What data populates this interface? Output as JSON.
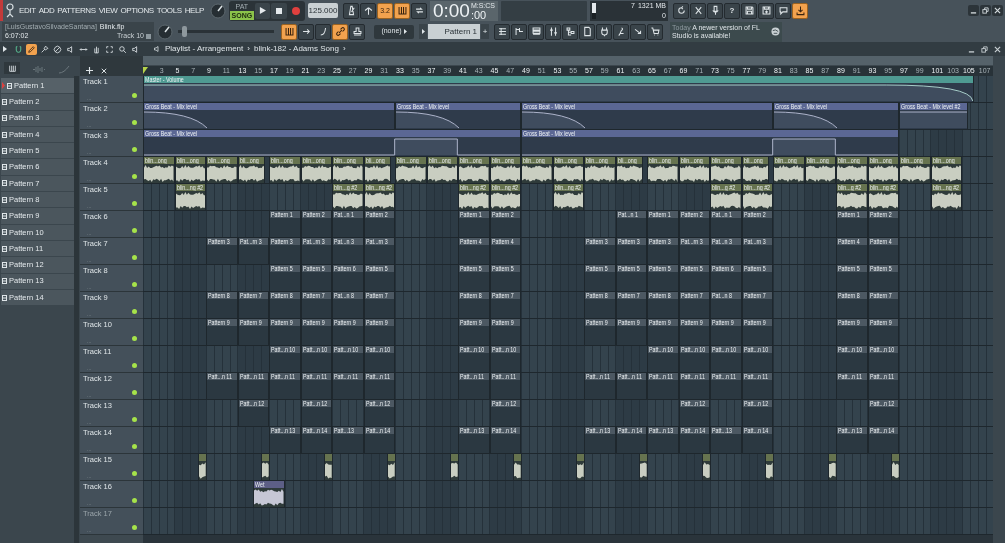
{
  "menu": [
    "EDIT",
    "ADD",
    "PATTERNS",
    "VIEW",
    "OPTIONS",
    "TOOLS",
    "HELP"
  ],
  "transport": {
    "modes": [
      {
        "label": "PAT",
        "selected": false
      },
      {
        "label": "SONG",
        "selected": true
      }
    ],
    "tempo": "125.000"
  },
  "toolbar_top": [
    {
      "kind": "metronome",
      "on": false
    },
    {
      "kind": "antenna",
      "on": false
    },
    {
      "kind": "countdown",
      "label": "3.2",
      "on": true
    },
    {
      "kind": "keys",
      "on": true
    },
    {
      "kind": "loop",
      "on": false
    }
  ],
  "clock": {
    "format": "M:S:CS",
    "time": "0:00",
    "fraction": ":00"
  },
  "monitor": {
    "cpu": "7",
    "memory": "1321 MB",
    "polyphony": "0"
  },
  "toolbar_right": [
    {
      "kind": "refresh",
      "on": false
    },
    {
      "kind": "cut",
      "on": false
    },
    {
      "kind": "mic",
      "on": false
    },
    {
      "kind": "help",
      "label": "?",
      "on": false
    },
    {
      "kind": "save",
      "on": false
    },
    {
      "kind": "saveas",
      "on": false
    },
    {
      "kind": "chat",
      "on": false
    },
    {
      "kind": "download",
      "on": true
    }
  ],
  "hint": {
    "owner": "[LuisGustavoSilvadeSantana]",
    "file": "Blink.flp",
    "time": "6:07:02",
    "target": "Track 10"
  },
  "pitch": {
    "level": 0.04
  },
  "toolbar_mid": [
    {
      "kind": "keys",
      "on": true
    },
    {
      "kind": "arrow",
      "on": false
    },
    {
      "kind": "curve",
      "on": false
    },
    {
      "kind": "link",
      "on": true
    },
    {
      "kind": "stamp",
      "on": false
    }
  ],
  "channel_target": "(none)",
  "pattern_selector": {
    "value": "Pattern 1",
    "add": "+"
  },
  "toolbar_windows": [
    {
      "kind": "playlist",
      "on": false
    },
    {
      "kind": "stepseq",
      "on": false
    },
    {
      "kind": "channels",
      "on": false
    },
    {
      "kind": "mixer",
      "on": false
    },
    {
      "kind": "browser",
      "on": false
    },
    {
      "kind": "page",
      "on": false
    },
    {
      "kind": "plug",
      "on": false
    },
    {
      "kind": "person",
      "on": false
    },
    {
      "kind": "send",
      "on": false
    },
    {
      "kind": "cart",
      "on": false
    }
  ],
  "news": {
    "date": "Today",
    "message": "A newer version of FL Studio is available!"
  },
  "playlist": {
    "tools": [
      {
        "kind": "magnet",
        "selected": false
      },
      {
        "kind": "pencil",
        "selected": true
      },
      {
        "kind": "brush",
        "selected": false
      },
      {
        "kind": "mute",
        "selected": false
      },
      {
        "kind": "speaker",
        "selected": false
      },
      {
        "kind": "slip",
        "selected": false
      },
      {
        "kind": "hand",
        "selected": false
      },
      {
        "kind": "select",
        "selected": false
      },
      {
        "kind": "zoom",
        "selected": false
      },
      {
        "kind": "speaker",
        "selected": false
      }
    ],
    "breadcrumb": [
      "Playlist - Arrangement",
      "›",
      "blink-182 - Adams Song",
      "›"
    ],
    "ruler": [
      "3",
      "5",
      "7",
      "9",
      "11",
      "13",
      "15",
      "17",
      "19",
      "21",
      "23",
      "25",
      "27",
      "29",
      "31",
      "33",
      "35",
      "37",
      "39",
      "41",
      "43",
      "45",
      "47",
      "49",
      "51",
      "53",
      "55",
      "57",
      "59",
      "61",
      "63",
      "65",
      "67",
      "69",
      "71",
      "73",
      "75",
      "77",
      "79",
      "81",
      "83",
      "85",
      "87",
      "89",
      "91",
      "93",
      "95",
      "97",
      "99",
      "101",
      "103",
      "105",
      "107"
    ],
    "patterns": [
      {
        "label": "Pattern 1",
        "selected": true
      },
      {
        "label": "Pattern 2",
        "selected": false
      },
      {
        "label": "Pattern 3",
        "selected": false
      },
      {
        "label": "Pattern 4",
        "selected": false
      },
      {
        "label": "Pattern 5",
        "selected": false
      },
      {
        "label": "Pattern 6",
        "selected": false
      },
      {
        "label": "Pattern 7",
        "selected": false
      },
      {
        "label": "Pattern 8",
        "selected": false
      },
      {
        "label": "Pattern 9",
        "selected": false
      },
      {
        "label": "Pattern 10",
        "selected": false
      },
      {
        "label": "Pattern 11",
        "selected": false
      },
      {
        "label": "Pattern 12",
        "selected": false
      },
      {
        "label": "Pattern 13",
        "selected": false
      },
      {
        "label": "Pattern 14",
        "selected": false
      }
    ],
    "tracks": [
      {
        "name": "Track 1",
        "options": "...",
        "enabled": true,
        "dimmed": false,
        "color": "#4f9a92",
        "clips": [
          {
            "kind": "automation",
            "label": "Master - Volume"
          }
        ]
      },
      {
        "name": "Track 2",
        "options": "...",
        "enabled": true,
        "dimmed": false,
        "color": "#5b6794",
        "clips": [
          {
            "kind": "automation",
            "label": "Gross Beat - Mix level"
          },
          {
            "kind": "automation",
            "label": "Gross Beat - Mix level"
          },
          {
            "kind": "automation",
            "label": "Gross Beat - Mix level"
          },
          {
            "kind": "automation",
            "label": "Gross Beat - Mix level"
          },
          {
            "kind": "automation",
            "label": "Gross Beat - Mix level #2"
          }
        ]
      },
      {
        "name": "Track 3",
        "options": "...",
        "enabled": true,
        "dimmed": false,
        "color": "#5b6794",
        "clips": [
          {
            "kind": "automation",
            "label": "Gross Beat - Mix level"
          },
          {
            "kind": "automation",
            "label": "Gross Beat - Mix level"
          }
        ]
      },
      {
        "name": "Track 4",
        "options": "...",
        "enabled": true,
        "dimmed": false,
        "color": "#66734f",
        "clips": [
          {
            "kind": "audio",
            "label": "blin...ong"
          },
          {
            "kind": "audio",
            "label": "blin...ong"
          },
          {
            "kind": "audio",
            "label": "blin...ong"
          },
          {
            "kind": "audio",
            "label": "bli...ong"
          },
          {
            "kind": "audio",
            "label": "blin...ong"
          },
          {
            "kind": "audio",
            "label": "blin...ong"
          },
          {
            "kind": "audio",
            "label": "blin...ong"
          },
          {
            "kind": "audio",
            "label": "bli...ong"
          },
          {
            "kind": "audio",
            "label": "blin...ong"
          },
          {
            "kind": "audio",
            "label": "blin...ong"
          },
          {
            "kind": "audio",
            "label": "blin...ong"
          },
          {
            "kind": "audio",
            "label": "blin...ong"
          },
          {
            "kind": "audio",
            "label": "blin...ong"
          },
          {
            "kind": "audio",
            "label": "blin...ong"
          },
          {
            "kind": "audio",
            "label": "blin...ong"
          },
          {
            "kind": "audio",
            "label": "bli...ong"
          },
          {
            "kind": "audio",
            "label": "blin...ong"
          },
          {
            "kind": "audio",
            "label": "blin...ong"
          },
          {
            "kind": "audio",
            "label": "blin...ong"
          },
          {
            "kind": "audio",
            "label": "bli...ong"
          },
          {
            "kind": "audio",
            "label": "blin...ong"
          },
          {
            "kind": "audio",
            "label": "blin...ong"
          },
          {
            "kind": "audio",
            "label": "blin...ong"
          },
          {
            "kind": "audio",
            "label": "blin...ong"
          },
          {
            "kind": "audio",
            "label": "blin...ong"
          },
          {
            "kind": "audio",
            "label": "blin...ong"
          }
        ]
      },
      {
        "name": "Track 5",
        "options": "...",
        "enabled": true,
        "dimmed": false,
        "color": "#66734f",
        "clips": [
          {
            "kind": "audio",
            "label": "blin...ng #2"
          },
          {
            "kind": "audio",
            "label": "blin...g #2"
          },
          {
            "kind": "audio",
            "label": "blin...ng #2"
          },
          {
            "kind": "audio",
            "label": "blin...ng #2"
          },
          {
            "kind": "audio",
            "label": "blin...ng #2"
          },
          {
            "kind": "audio",
            "label": "blin...ng #2"
          },
          {
            "kind": "audio",
            "label": "blin...g #2"
          },
          {
            "kind": "audio",
            "label": "blin...ng #2"
          },
          {
            "kind": "audio",
            "label": "blin...g #2"
          },
          {
            "kind": "audio",
            "label": "blin...ng #2"
          },
          {
            "kind": "audio",
            "label": "blin...ng #2"
          }
        ]
      },
      {
        "name": "Track 6",
        "options": "...",
        "enabled": true,
        "dimmed": false,
        "color": "#4c5862",
        "clips": [
          {
            "kind": "pattern",
            "label": "Pattern 1"
          },
          {
            "kind": "pattern",
            "label": "Pattern 2"
          },
          {
            "kind": "pattern",
            "label": "Pat...n 1"
          },
          {
            "kind": "pattern",
            "label": "Pattern 2"
          },
          {
            "kind": "pattern",
            "label": "Pattern 1"
          },
          {
            "kind": "pattern",
            "label": "Pattern 2"
          },
          {
            "kind": "pattern",
            "label": "Pat...n 1"
          },
          {
            "kind": "pattern",
            "label": "Pattern 1"
          },
          {
            "kind": "pattern",
            "label": "Pattern 2"
          },
          {
            "kind": "pattern",
            "label": "Pat...n 1"
          },
          {
            "kind": "pattern",
            "label": "Pattern 2"
          },
          {
            "kind": "pattern",
            "label": "Pattern 1"
          },
          {
            "kind": "pattern",
            "label": "Pattern 2"
          }
        ]
      },
      {
        "name": "Track 7",
        "options": "...",
        "enabled": true,
        "dimmed": false,
        "color": "#4c5862",
        "clips": [
          {
            "kind": "pattern",
            "label": "Pattern 3"
          },
          {
            "kind": "pattern",
            "label": "Pat...rn 3"
          },
          {
            "kind": "pattern",
            "label": "Pattern 3"
          },
          {
            "kind": "pattern",
            "label": "Pat...rn 3"
          },
          {
            "kind": "pattern",
            "label": "Pat...n 3"
          },
          {
            "kind": "pattern",
            "label": "Pat...rn 3"
          },
          {
            "kind": "pattern",
            "label": "Pattern 4"
          },
          {
            "kind": "pattern",
            "label": "Pattern 4"
          },
          {
            "kind": "pattern",
            "label": "Pattern 3"
          },
          {
            "kind": "pattern",
            "label": "Pattern 3"
          },
          {
            "kind": "pattern",
            "label": "Pattern 3"
          },
          {
            "kind": "pattern",
            "label": "Pat...rn 3"
          },
          {
            "kind": "pattern",
            "label": "Pat...n 3"
          },
          {
            "kind": "pattern",
            "label": "Pat...rn 3"
          },
          {
            "kind": "pattern",
            "label": "Pattern 4"
          },
          {
            "kind": "pattern",
            "label": "Pattern 4"
          }
        ]
      },
      {
        "name": "Track 8",
        "options": "...",
        "enabled": true,
        "dimmed": false,
        "color": "#4c5862",
        "clips": [
          {
            "kind": "pattern",
            "label": "Pattern 5"
          },
          {
            "kind": "pattern",
            "label": "Pattern 5"
          },
          {
            "kind": "pattern",
            "label": "Pattern 6"
          },
          {
            "kind": "pattern",
            "label": "Pattern 5"
          },
          {
            "kind": "pattern",
            "label": "Pattern 5"
          },
          {
            "kind": "pattern",
            "label": "Pattern 5"
          },
          {
            "kind": "pattern",
            "label": "Pattern 5"
          },
          {
            "kind": "pattern",
            "label": "Pattern 5"
          },
          {
            "kind": "pattern",
            "label": "Pattern 5"
          },
          {
            "kind": "pattern",
            "label": "Pattern 5"
          },
          {
            "kind": "pattern",
            "label": "Pattern 6"
          },
          {
            "kind": "pattern",
            "label": "Pattern 5"
          },
          {
            "kind": "pattern",
            "label": "Pattern 5"
          },
          {
            "kind": "pattern",
            "label": "Pattern 5"
          }
        ]
      },
      {
        "name": "Track 9",
        "options": "...",
        "enabled": true,
        "dimmed": false,
        "color": "#4c5862",
        "clips": [
          {
            "kind": "pattern",
            "label": "Pattern 8"
          },
          {
            "kind": "pattern",
            "label": "Pattern 7"
          },
          {
            "kind": "pattern",
            "label": "Pattern 8"
          },
          {
            "kind": "pattern",
            "label": "Pattern 7"
          },
          {
            "kind": "pattern",
            "label": "Pat...n 8"
          },
          {
            "kind": "pattern",
            "label": "Pattern 7"
          },
          {
            "kind": "pattern",
            "label": "Pattern 8"
          },
          {
            "kind": "pattern",
            "label": "Pattern 7"
          },
          {
            "kind": "pattern",
            "label": "Pattern 8"
          },
          {
            "kind": "pattern",
            "label": "Pattern 7"
          },
          {
            "kind": "pattern",
            "label": "Pattern 8"
          },
          {
            "kind": "pattern",
            "label": "Pattern 7"
          },
          {
            "kind": "pattern",
            "label": "Pat...n 8"
          },
          {
            "kind": "pattern",
            "label": "Pattern 7"
          },
          {
            "kind": "pattern",
            "label": "Pattern 8"
          },
          {
            "kind": "pattern",
            "label": "Pattern 7"
          }
        ]
      },
      {
        "name": "Track 10",
        "options": "...",
        "enabled": true,
        "dimmed": false,
        "color": "#4c5862",
        "clips": [
          {
            "kind": "pattern",
            "label": "Pattern 9"
          },
          {
            "kind": "pattern",
            "label": "Pattern 9"
          },
          {
            "kind": "pattern",
            "label": "Pattern 9"
          },
          {
            "kind": "pattern",
            "label": "Pattern 9"
          },
          {
            "kind": "pattern",
            "label": "Pattern 9"
          },
          {
            "kind": "pattern",
            "label": "Pattern 9"
          },
          {
            "kind": "pattern",
            "label": "Pattern 9"
          },
          {
            "kind": "pattern",
            "label": "Pattern 9"
          },
          {
            "kind": "pattern",
            "label": "Pattern 9"
          },
          {
            "kind": "pattern",
            "label": "Pattern 9"
          },
          {
            "kind": "pattern",
            "label": "Pattern 9"
          },
          {
            "kind": "pattern",
            "label": "Pattern 9"
          },
          {
            "kind": "pattern",
            "label": "Pattern 9"
          },
          {
            "kind": "pattern",
            "label": "Pattern 9"
          },
          {
            "kind": "pattern",
            "label": "Pattern 9"
          },
          {
            "kind": "pattern",
            "label": "Pattern 9"
          }
        ]
      },
      {
        "name": "Track 11",
        "options": "...",
        "enabled": true,
        "dimmed": false,
        "color": "#4c5862",
        "clips": [
          {
            "kind": "pattern",
            "label": "Patt...n 10"
          },
          {
            "kind": "pattern",
            "label": "Patt...n 10"
          },
          {
            "kind": "pattern",
            "label": "Patt...n 10"
          },
          {
            "kind": "pattern",
            "label": "Patt...n 10"
          },
          {
            "kind": "pattern",
            "label": "Patt...n 10"
          },
          {
            "kind": "pattern",
            "label": "Patt...n 10"
          },
          {
            "kind": "pattern",
            "label": "Patt...n 10"
          },
          {
            "kind": "pattern",
            "label": "Patt...n 10"
          },
          {
            "kind": "pattern",
            "label": "Patt...n 10"
          },
          {
            "kind": "pattern",
            "label": "Patt...n 10"
          },
          {
            "kind": "pattern",
            "label": "Patt...n 10"
          },
          {
            "kind": "pattern",
            "label": "Patt...n 10"
          }
        ]
      },
      {
        "name": "Track 12",
        "options": "...",
        "enabled": true,
        "dimmed": false,
        "color": "#4c5862",
        "clips": [
          {
            "kind": "pattern",
            "label": "Patt...n 11"
          },
          {
            "kind": "pattern",
            "label": "Patt...n 11"
          },
          {
            "kind": "pattern",
            "label": "Patt...n 11"
          },
          {
            "kind": "pattern",
            "label": "Patt...n 11"
          },
          {
            "kind": "pattern",
            "label": "Patt...n 11"
          },
          {
            "kind": "pattern",
            "label": "Patt...n 11"
          },
          {
            "kind": "pattern",
            "label": "Patt...n 11"
          },
          {
            "kind": "pattern",
            "label": "Patt...n 11"
          },
          {
            "kind": "pattern",
            "label": "Patt...n 11"
          },
          {
            "kind": "pattern",
            "label": "Patt...n 11"
          },
          {
            "kind": "pattern",
            "label": "Patt...n 11"
          },
          {
            "kind": "pattern",
            "label": "Patt...n 11"
          },
          {
            "kind": "pattern",
            "label": "Patt...n 11"
          },
          {
            "kind": "pattern",
            "label": "Patt...n 11"
          },
          {
            "kind": "pattern",
            "label": "Patt...n 11"
          },
          {
            "kind": "pattern",
            "label": "Patt...n 11"
          }
        ]
      },
      {
        "name": "Track 13",
        "options": "...",
        "enabled": true,
        "dimmed": false,
        "color": "#4c5862",
        "clips": [
          {
            "kind": "pattern",
            "label": "Patt...n 12"
          },
          {
            "kind": "pattern",
            "label": "Patt...n 12"
          },
          {
            "kind": "pattern",
            "label": "Patt...n 12"
          },
          {
            "kind": "pattern",
            "label": "Patt...n 12"
          },
          {
            "kind": "pattern",
            "label": "Patt...n 12"
          },
          {
            "kind": "pattern",
            "label": "Patt...n 12"
          },
          {
            "kind": "pattern",
            "label": "Patt...n 12"
          }
        ]
      },
      {
        "name": "Track 14",
        "options": "...",
        "enabled": true,
        "dimmed": false,
        "color": "#4c5862",
        "clips": [
          {
            "kind": "pattern",
            "label": "Patt...n 13"
          },
          {
            "kind": "pattern",
            "label": "Patt...n 14"
          },
          {
            "kind": "pattern",
            "label": "Patt...13"
          },
          {
            "kind": "pattern",
            "label": "Patt...n 14"
          },
          {
            "kind": "pattern",
            "label": "Patt...n 13"
          },
          {
            "kind": "pattern",
            "label": "Patt...n 14"
          },
          {
            "kind": "pattern",
            "label": "Patt...n 13"
          },
          {
            "kind": "pattern",
            "label": "Patt...n 14"
          },
          {
            "kind": "pattern",
            "label": "Patt...n 13"
          },
          {
            "kind": "pattern",
            "label": "Patt...n 14"
          },
          {
            "kind": "pattern",
            "label": "Patt...13"
          },
          {
            "kind": "pattern",
            "label": "Patt...n 14"
          },
          {
            "kind": "pattern",
            "label": "Patt...n 13"
          },
          {
            "kind": "pattern",
            "label": "Patt...n 14"
          }
        ]
      },
      {
        "name": "Track 15",
        "options": "...",
        "enabled": true,
        "dimmed": false,
        "color": "#66734f",
        "clips": [
          {
            "kind": "audio"
          },
          {
            "kind": "audio"
          },
          {
            "kind": "audio"
          },
          {
            "kind": "audio"
          },
          {
            "kind": "audio"
          },
          {
            "kind": "audio"
          },
          {
            "kind": "audio"
          },
          {
            "kind": "audio"
          },
          {
            "kind": "audio"
          },
          {
            "kind": "audio"
          },
          {
            "kind": "audio"
          },
          {
            "kind": "audio"
          }
        ]
      },
      {
        "name": "Track 16",
        "options": "...",
        "enabled": true,
        "dimmed": false,
        "color": "#5d5f86",
        "clips": [
          {
            "kind": "audio",
            "label": "Wet"
          }
        ]
      },
      {
        "name": "Track 17",
        "options": "...",
        "enabled": true,
        "dimmed": true
      }
    ]
  }
}
